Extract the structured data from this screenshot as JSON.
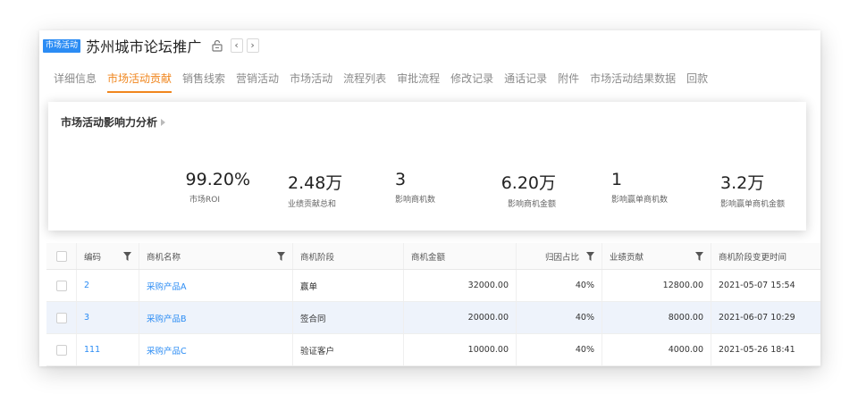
{
  "header": {
    "tag": "市场活动",
    "title": "苏州城市论坛推广",
    "prev": "‹",
    "next": "›"
  },
  "tabs": [
    {
      "label": "详细信息"
    },
    {
      "label": "市场活动贡献"
    },
    {
      "label": "销售线索"
    },
    {
      "label": "营销活动"
    },
    {
      "label": "市场活动"
    },
    {
      "label": "流程列表"
    },
    {
      "label": "审批流程"
    },
    {
      "label": "修改记录"
    },
    {
      "label": "通话记录"
    },
    {
      "label": "附件"
    },
    {
      "label": "市场活动结果数据"
    },
    {
      "label": "回款"
    }
  ],
  "active_tab": "市场活动贡献",
  "analysis": {
    "title": "市场活动影响力分析",
    "metrics": [
      {
        "value": "99.20%",
        "label": "市场ROI"
      },
      {
        "value": "2.48万",
        "label": "业绩贡献总和"
      },
      {
        "value": "3",
        "label": "影响商机数"
      },
      {
        "value": "6.20万",
        "label": "影响商机金额"
      },
      {
        "value": "1",
        "label": "影响赢单商机数"
      },
      {
        "value": "3.2万",
        "label": "影响赢单商机金额"
      }
    ]
  },
  "table": {
    "columns": [
      "编码",
      "商机名称",
      "商机阶段",
      "商机金额",
      "归因占比",
      "业绩贡献",
      "商机阶段变更时间"
    ],
    "rows": [
      [
        "2",
        "采购产品A",
        "赢单",
        "32000.00",
        "40%",
        "12800.00",
        "2021-05-07 15:54"
      ],
      [
        "3",
        "采购产品B",
        "签合同",
        "20000.00",
        "40%",
        "8000.00",
        "2021-06-07 10:29"
      ],
      [
        "111",
        "采购产品C",
        "验证客户",
        "10000.00",
        "40%",
        "4000.00",
        "2021-05-26 18:41"
      ]
    ]
  },
  "colors": {
    "accent": "#f0861e",
    "link": "#2b8cf4",
    "tag_bg": "#2b8cf4"
  }
}
